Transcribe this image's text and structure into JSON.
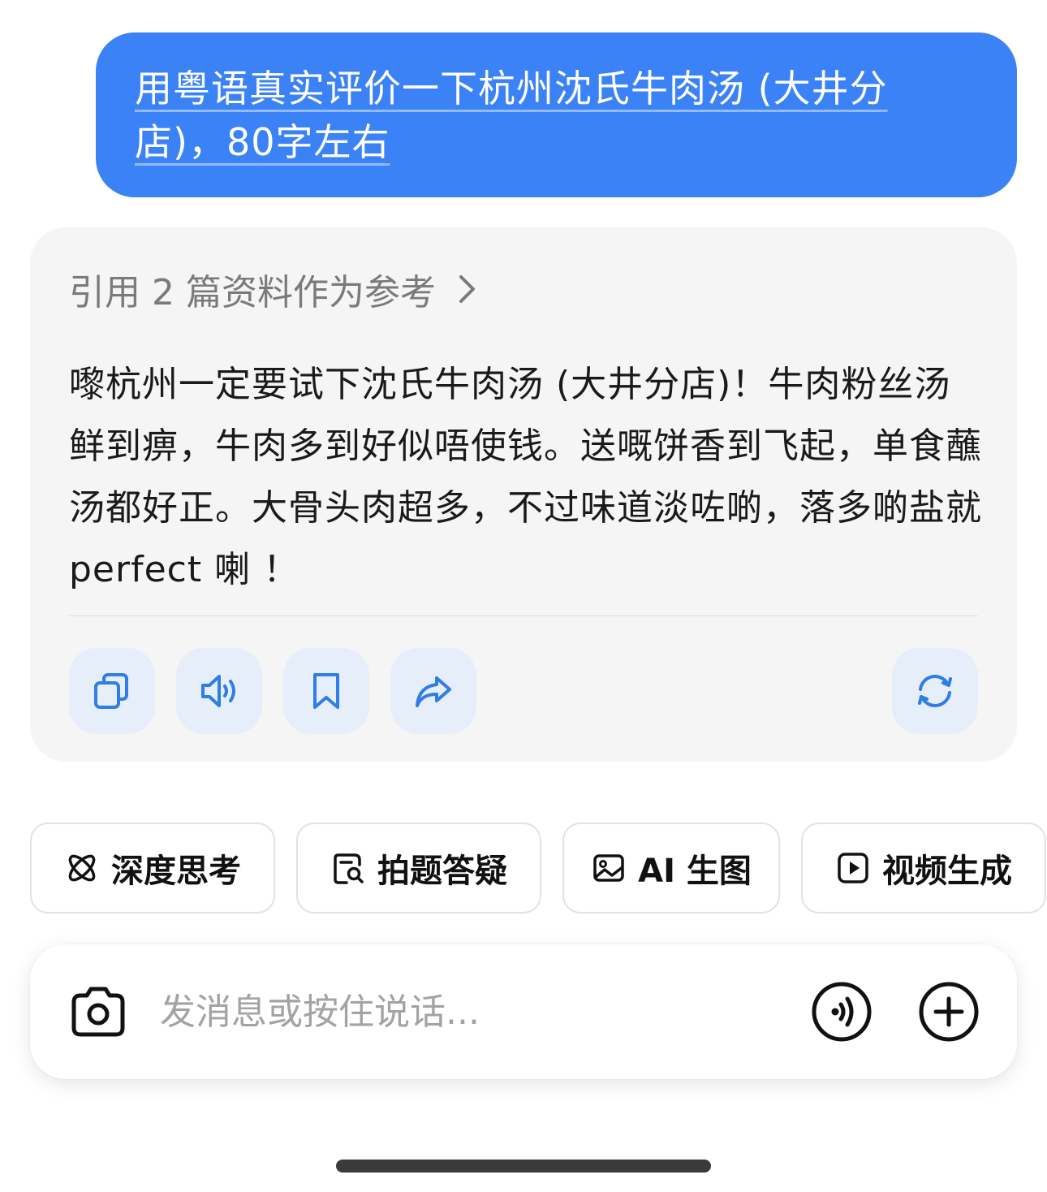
{
  "user_message": {
    "text": "用粤语真实评价一下杭州沈氏牛肉汤 (大井分店)，80字左右"
  },
  "assistant": {
    "reference_label": "引用 2 篇资料作为参考",
    "reference_icon": "chevron-right-icon",
    "answer": "嚟杭州一定要试下沈氏牛肉汤 (大井分店)！牛肉粉丝汤鲜到痹，牛肉多到好似唔使钱。送嘅饼香到飞起，单食蘸汤都好正。大骨头肉超多，不过味道淡咗啲，落多啲盐就 perfect 喇 ！",
    "actions": [
      {
        "name": "copy",
        "icon": "copy-icon"
      },
      {
        "name": "read-aloud",
        "icon": "speaker-icon"
      },
      {
        "name": "bookmark",
        "icon": "bookmark-icon"
      },
      {
        "name": "share",
        "icon": "share-icon"
      },
      {
        "name": "regenerate",
        "icon": "refresh-icon"
      }
    ]
  },
  "chips": [
    {
      "label": "深度思考",
      "icon": "atom-icon"
    },
    {
      "label": "拍题答疑",
      "icon": "search-document-icon"
    },
    {
      "label": "AI 生图",
      "icon": "image-icon"
    },
    {
      "label": "视频生成",
      "icon": "play-icon"
    }
  ],
  "input": {
    "placeholder": "发消息或按住说话...",
    "value": ""
  },
  "colors": {
    "user_bubble": "#3b82f6",
    "accent_icon": "#2f7de6",
    "card_bg": "#f5f5f5",
    "action_bg": "#e6eef9"
  }
}
